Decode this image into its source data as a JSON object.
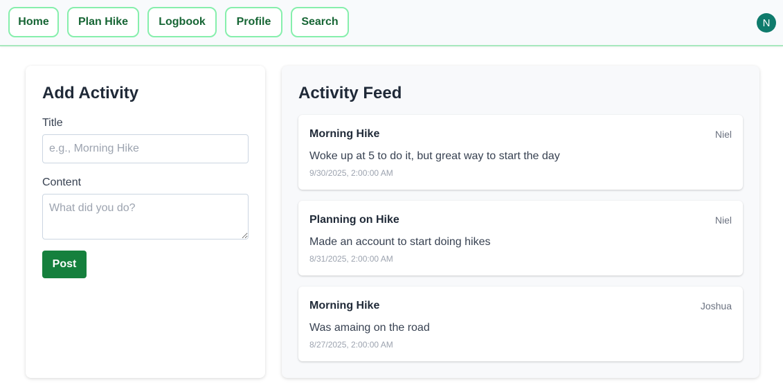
{
  "nav": {
    "items": [
      {
        "label": "Home"
      },
      {
        "label": "Plan Hike"
      },
      {
        "label": "Logbook"
      },
      {
        "label": "Profile"
      },
      {
        "label": "Search"
      }
    ],
    "avatar_initial": "N"
  },
  "add_activity": {
    "title": "Add Activity",
    "title_label": "Title",
    "title_placeholder": "e.g., Morning Hike",
    "title_value": "",
    "content_label": "Content",
    "content_placeholder": "What did you do?",
    "content_value": "",
    "post_label": "Post"
  },
  "feed": {
    "title": "Activity Feed",
    "items": [
      {
        "title": "Morning Hike",
        "author": "Niel",
        "content": "Woke up at 5 to do it, but great way to start the day",
        "date": "9/30/2025, 2:00:00 AM"
      },
      {
        "title": "Planning on Hike",
        "author": "Niel",
        "content": "Made an account to start doing hikes",
        "date": "8/31/2025, 2:00:00 AM"
      },
      {
        "title": "Morning Hike",
        "author": "Joshua",
        "content": "Was amaing on the road",
        "date": "8/27/2025, 2:00:00 AM"
      }
    ]
  },
  "colors": {
    "accent": "#15803d",
    "nav_border": "#86efac",
    "avatar_bg": "#0f7b6c"
  }
}
